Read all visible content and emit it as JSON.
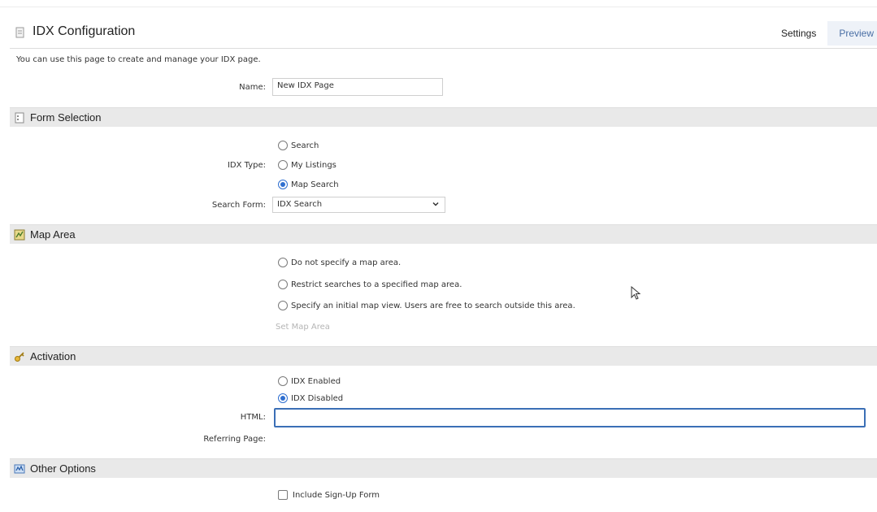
{
  "header": {
    "title": "IDX Configuration",
    "tabs": [
      {
        "label": "Settings",
        "active": true
      },
      {
        "label": "Preview",
        "active": false
      }
    ]
  },
  "intro_text": "You can use this page to create and manage your IDX page.",
  "name_field": {
    "label": "Name:",
    "value": "New IDX Page"
  },
  "sections": {
    "form_selection": {
      "title": "Form Selection",
      "icon": "form-icon"
    },
    "map_area": {
      "title": "Map Area",
      "icon": "map-icon"
    },
    "activation": {
      "title": "Activation",
      "icon": "key-icon"
    },
    "other_options": {
      "title": "Other Options",
      "icon": "options-icon"
    }
  },
  "idx_type": {
    "label": "IDX Type:",
    "options": [
      {
        "label": "Search",
        "checked": false
      },
      {
        "label": "My Listings",
        "checked": false
      },
      {
        "label": "Map Search",
        "checked": true
      }
    ]
  },
  "search_form": {
    "label": "Search Form:",
    "value": "IDX Search"
  },
  "map_area_options": [
    {
      "label": "Do not specify a map area.",
      "checked": false
    },
    {
      "label": "Restrict searches to a specified map area.",
      "checked": false
    },
    {
      "label": "Specify an initial map view. Users are free to search outside this area.",
      "checked": false
    }
  ],
  "set_map_area_link": "Set Map Area",
  "activation_options": [
    {
      "label": "IDX Enabled",
      "checked": false
    },
    {
      "label": "IDX Disabled",
      "checked": true
    }
  ],
  "html_field": {
    "label": "HTML:",
    "value": ""
  },
  "referring_page": {
    "label": "Referring Page:"
  },
  "include_signup": {
    "label": "Include Sign-Up Form",
    "checked": false
  },
  "colors": {
    "accent": "#2f6fd0",
    "section_bg": "#e9e9e9",
    "input_focus": "#3b6fb6"
  }
}
